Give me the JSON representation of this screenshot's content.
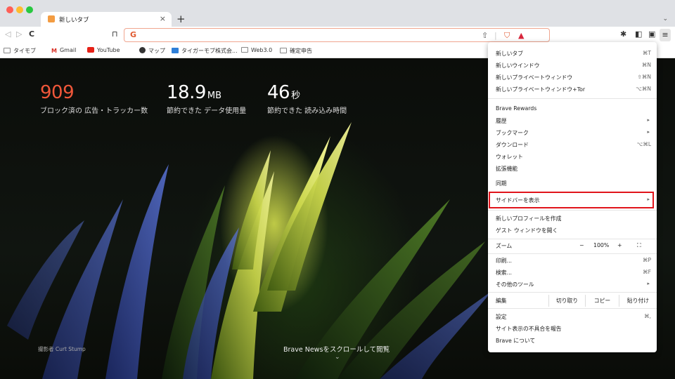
{
  "tab": {
    "title": "新しいタブ",
    "close": "×",
    "new": "+"
  },
  "toolbar": {
    "back": "◁",
    "forward": "▷",
    "reload": "C",
    "bookmark": "⊓",
    "search_logo": "G"
  },
  "bookmarks": [
    {
      "label": "タイモブ",
      "icon": "folder-icon"
    },
    {
      "label": "Gmail",
      "icon": "gmail-icon"
    },
    {
      "label": "YouTube",
      "icon": "youtube-icon"
    },
    {
      "label": "マップ",
      "icon": "maps-icon"
    },
    {
      "label": "タイガーモブ株式会...",
      "icon": "site-icon"
    },
    {
      "label": "Web3.0",
      "icon": "folder-icon"
    },
    {
      "label": "確定申告",
      "icon": "folder-icon"
    }
  ],
  "stats": [
    {
      "value": "909",
      "unit": "",
      "label": "ブロック済の 広告・トラッカー数",
      "color": "#f0573a"
    },
    {
      "value": "18.9",
      "unit": "MB",
      "label": "節約できた データ使用量",
      "color": "#ffffff"
    },
    {
      "value": "46",
      "unit": "秒",
      "label": "節約できた 読み込み時間",
      "color": "#ffffff"
    }
  ],
  "footer": {
    "credit": "撮影者 Curt Stump",
    "news": "Brave Newsをスクロールして閲覧",
    "chevron": "⌄"
  },
  "menu": {
    "items": [
      {
        "label": "新しいタブ",
        "shortcut": "⌘T"
      },
      {
        "label": "新しいウインドウ",
        "shortcut": "⌘N"
      },
      {
        "label": "新しいプライベートウィンドウ",
        "shortcut": "⇧⌘N"
      },
      {
        "label": "新しいプライベートウィンドウ+Tor",
        "shortcut": "⌥⌘N"
      },
      {
        "label": "Brave Rewards",
        "shortcut": ""
      },
      {
        "label": "履歴",
        "shortcut": "▸"
      },
      {
        "label": "ブックマーク",
        "shortcut": "▸"
      },
      {
        "label": "ダウンロード",
        "shortcut": "⌥⌘L"
      },
      {
        "label": "ウォレット",
        "shortcut": ""
      },
      {
        "label": "拡張機能",
        "shortcut": ""
      },
      {
        "label": "同期",
        "shortcut": ""
      },
      {
        "label": "サイドバーを表示",
        "shortcut": "▸"
      },
      {
        "label": "新しいプロフィールを作成",
        "shortcut": ""
      },
      {
        "label": "ゲスト ウィンドウを開く",
        "shortcut": ""
      },
      {
        "label": "印刷...",
        "shortcut": "⌘P"
      },
      {
        "label": "検索...",
        "shortcut": "⌘F"
      },
      {
        "label": "その他のツール",
        "shortcut": "▸"
      },
      {
        "label": "設定",
        "shortcut": "⌘,"
      },
      {
        "label": "サイト表示の不具合を報告",
        "shortcut": ""
      },
      {
        "label": "Brave について",
        "shortcut": ""
      }
    ],
    "zoom": {
      "label": "ズーム",
      "minus": "−",
      "value": "100%",
      "plus": "+",
      "fullscreen": "⛶"
    },
    "edit": {
      "label": "編集",
      "cut": "切り取り",
      "copy": "コピー",
      "paste": "貼り付け"
    }
  }
}
